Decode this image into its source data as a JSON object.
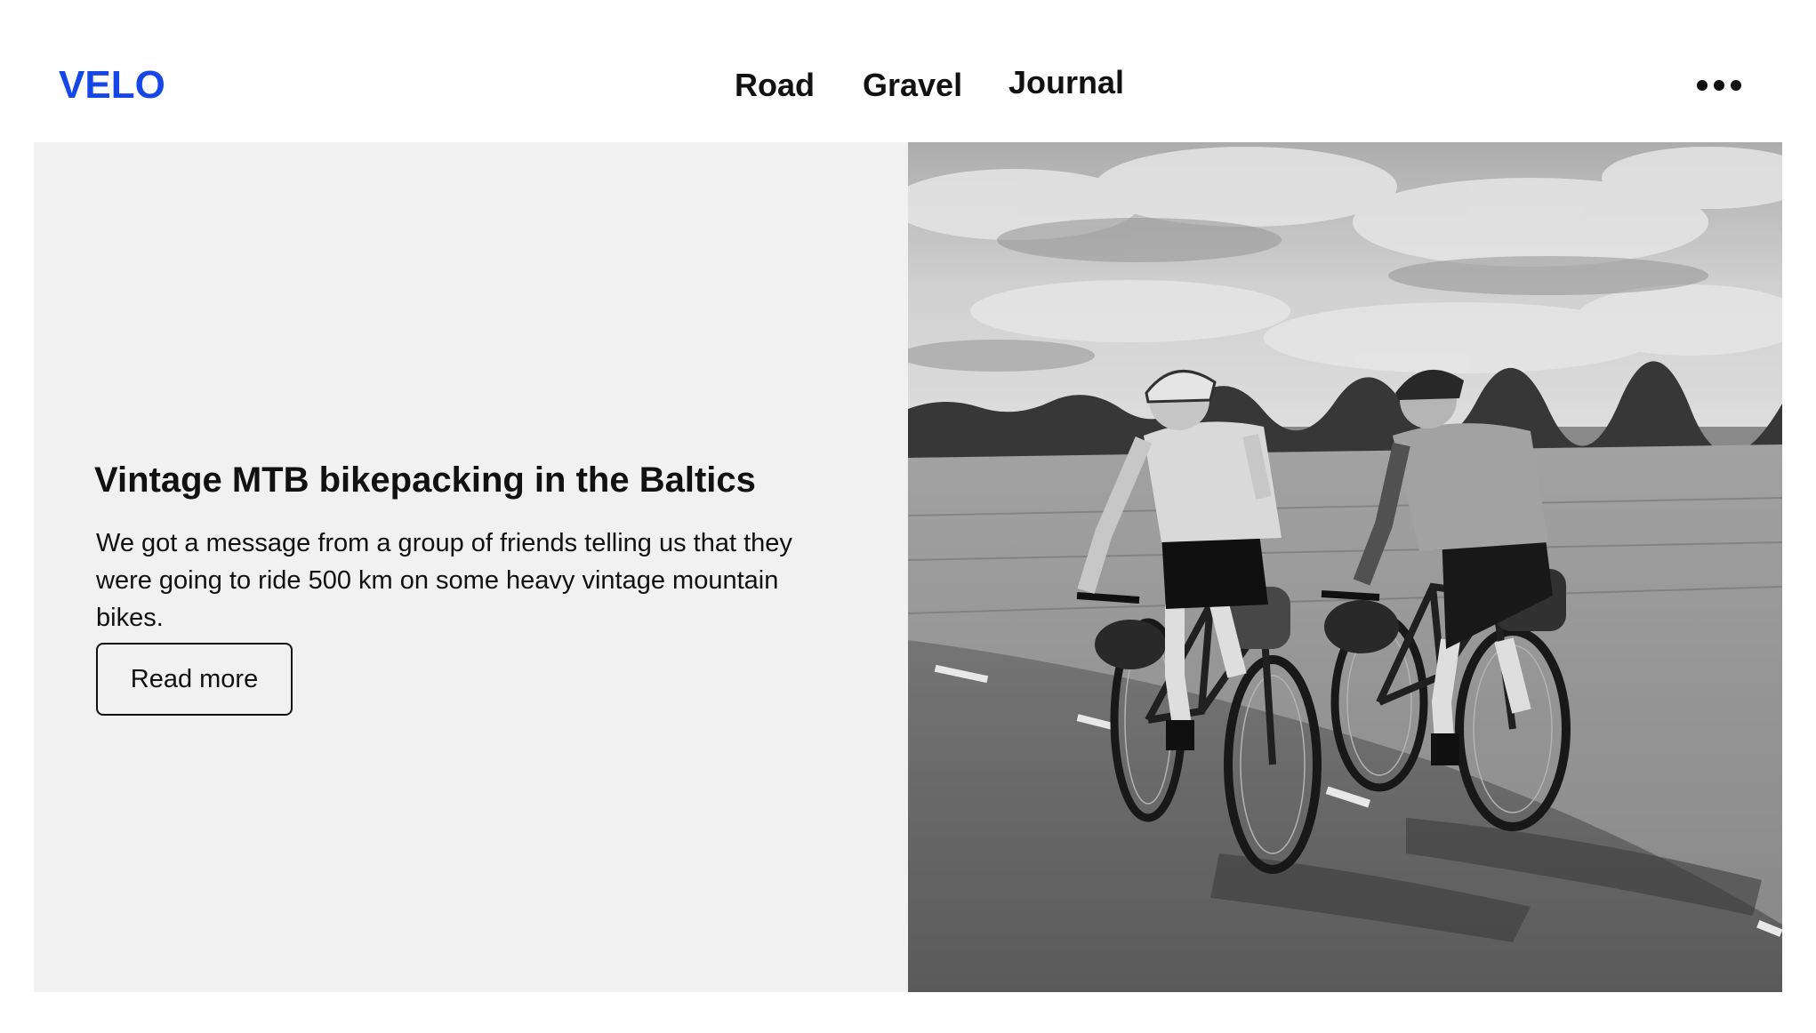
{
  "header": {
    "logo": "VELO",
    "nav": [
      {
        "label": "Road"
      },
      {
        "label": "Gravel"
      },
      {
        "label": "Journal"
      }
    ],
    "more_icon": "more-horizontal-icon"
  },
  "hero": {
    "title": "Vintage MTB bikepacking in the Baltics",
    "description": "We got a message from a group of friends telling us that they were going to ride 500 km on some heavy vintage mountain bikes.",
    "cta_label": "Read more",
    "image_description": "Black and white photo of two cyclists riding loaded vintage mountain bikes on a country road beside a field"
  },
  "colors": {
    "brand": "#1446e8",
    "text": "#111111",
    "panel_bg": "#f1f1f1",
    "page_bg": "#ffffff"
  }
}
